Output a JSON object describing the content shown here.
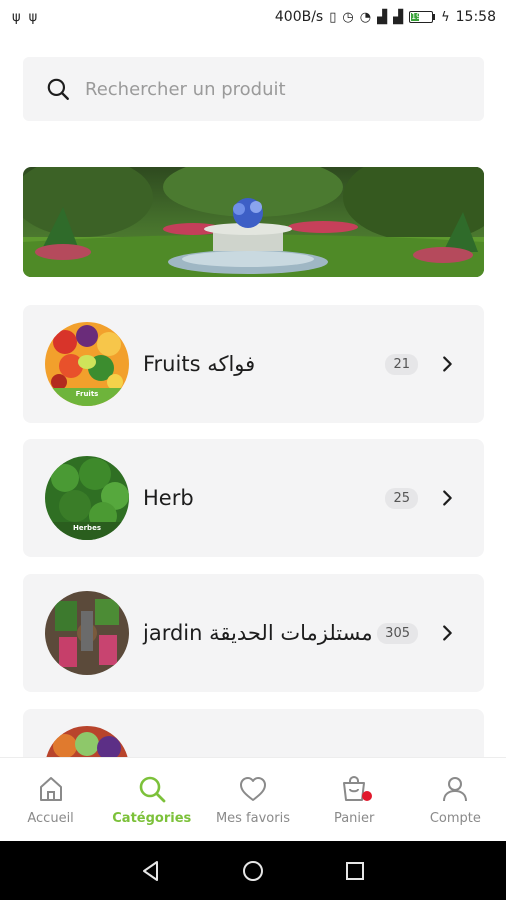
{
  "status_bar": {
    "left_icons": [
      "usb-icon",
      "usb-icon"
    ],
    "net_speed": "400B/s",
    "time": "15:58",
    "battery": "19"
  },
  "search": {
    "placeholder": "Rechercher un produit"
  },
  "categories": [
    {
      "name": "Fruits فواكه",
      "count": "21",
      "thumb_label": "Fruits"
    },
    {
      "name": "Herb",
      "count": "25",
      "thumb_label": "Herbes"
    },
    {
      "name": "jardin مستلزمات الحديقة",
      "count": "305",
      "thumb_label": ""
    }
  ],
  "bottom_nav": {
    "items": [
      {
        "label": "Accueil",
        "icon": "home-icon"
      },
      {
        "label": "Catégories",
        "icon": "search-icon"
      },
      {
        "label": "Mes favoris",
        "icon": "heart-icon"
      },
      {
        "label": "Panier",
        "icon": "basket-icon"
      },
      {
        "label": "Compte",
        "icon": "user-icon"
      }
    ]
  },
  "colors": {
    "accent": "#7cc13a",
    "card_bg": "#f4f4f5",
    "badge_red": "#e1192c"
  }
}
